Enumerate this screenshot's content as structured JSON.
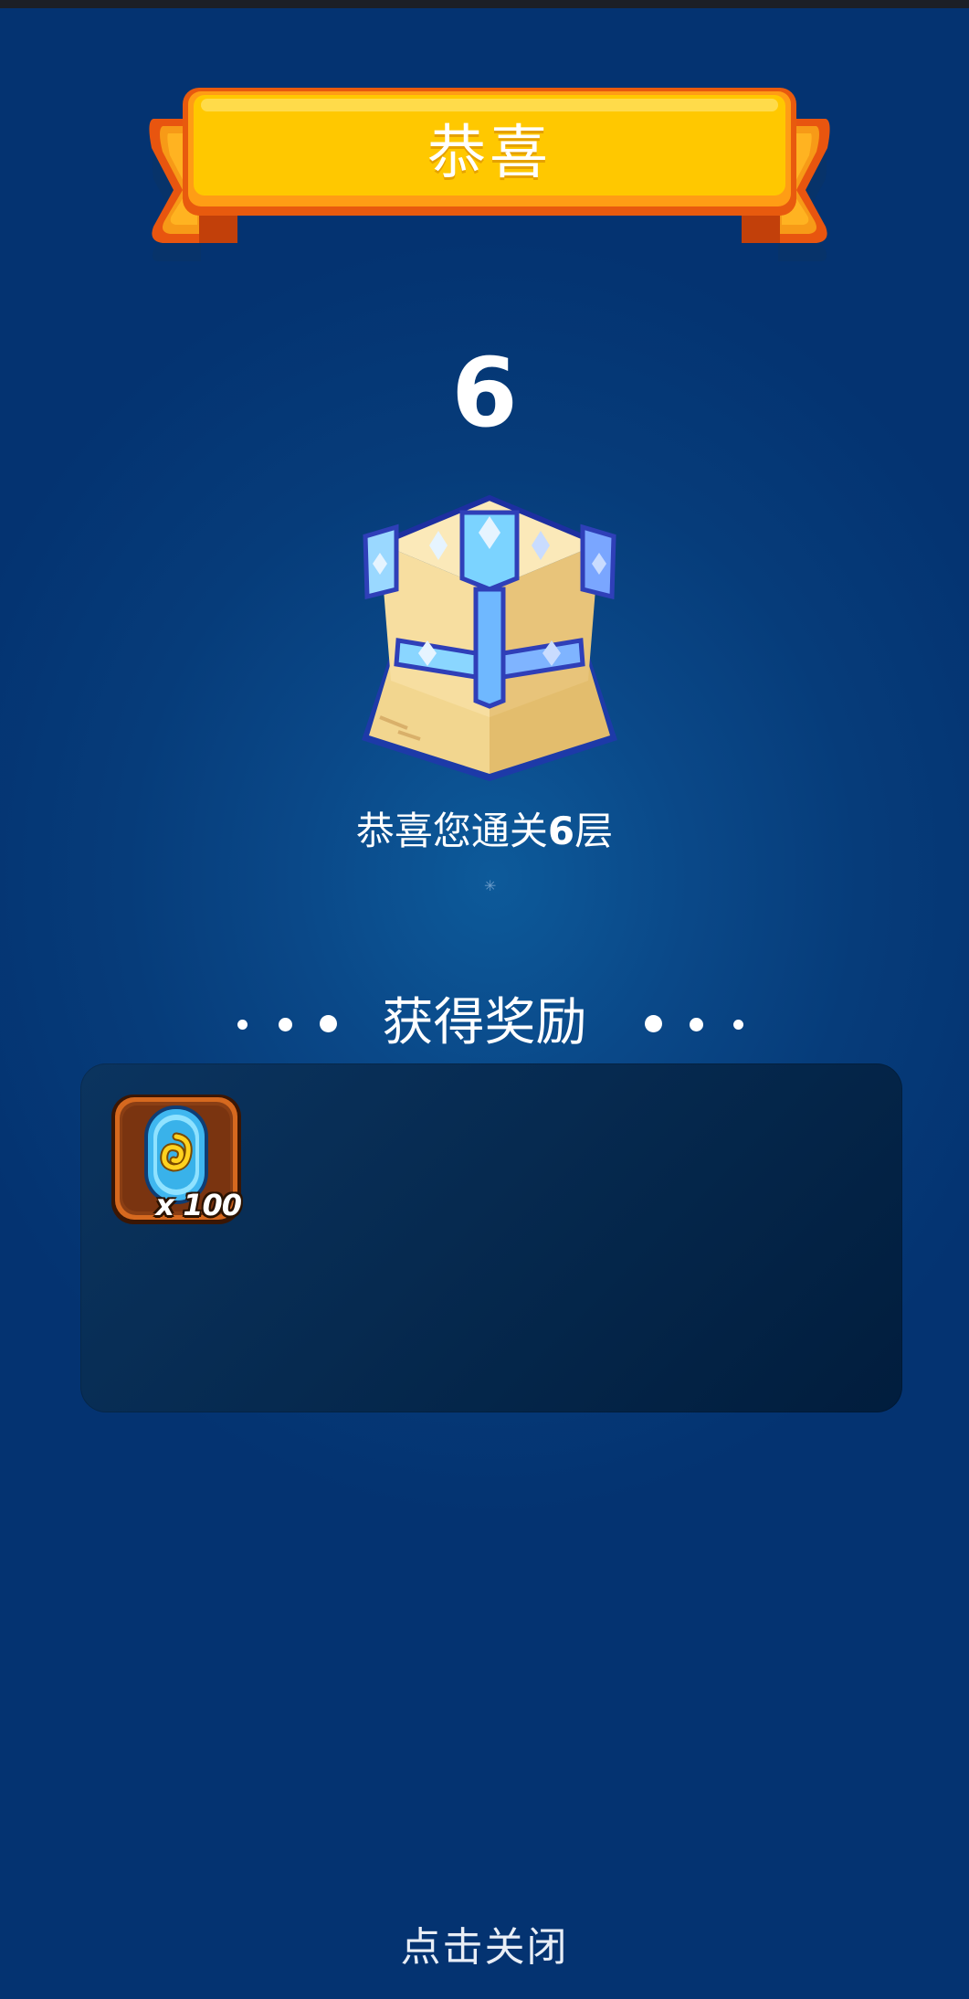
{
  "banner": {
    "title": "恭喜"
  },
  "level": {
    "number": "6",
    "congrats_prefix": "恭喜您通关",
    "congrats_number": "6",
    "congrats_suffix": "层"
  },
  "rewards": {
    "title": "获得奖励",
    "items": [
      {
        "icon": "blue-gem-ticket-icon",
        "quantity": "x 100"
      }
    ]
  },
  "footer": {
    "close_label": "点击关闭"
  },
  "colors": {
    "banner_yellow": "#ffc800",
    "banner_orange": "#f07a10",
    "panel_dark": "#062a50",
    "background": "#043371",
    "item_frame_brown": "#7a3a12"
  }
}
